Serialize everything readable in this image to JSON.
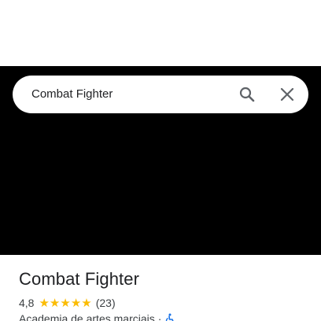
{
  "search": {
    "query": "Combat Fighter",
    "search_icon": "search-icon",
    "close_icon": "close-icon"
  },
  "place": {
    "name": "Combat Fighter",
    "rating": "4,8",
    "stars": 5,
    "review_count": "(23)",
    "category": "Academia de artes marciais",
    "separator": "·",
    "accessibility_icon": "wheelchair-icon"
  },
  "colors": {
    "map_background": "#000000",
    "star": "#fbbc04",
    "accessibility_icon": "#1a73e8"
  }
}
